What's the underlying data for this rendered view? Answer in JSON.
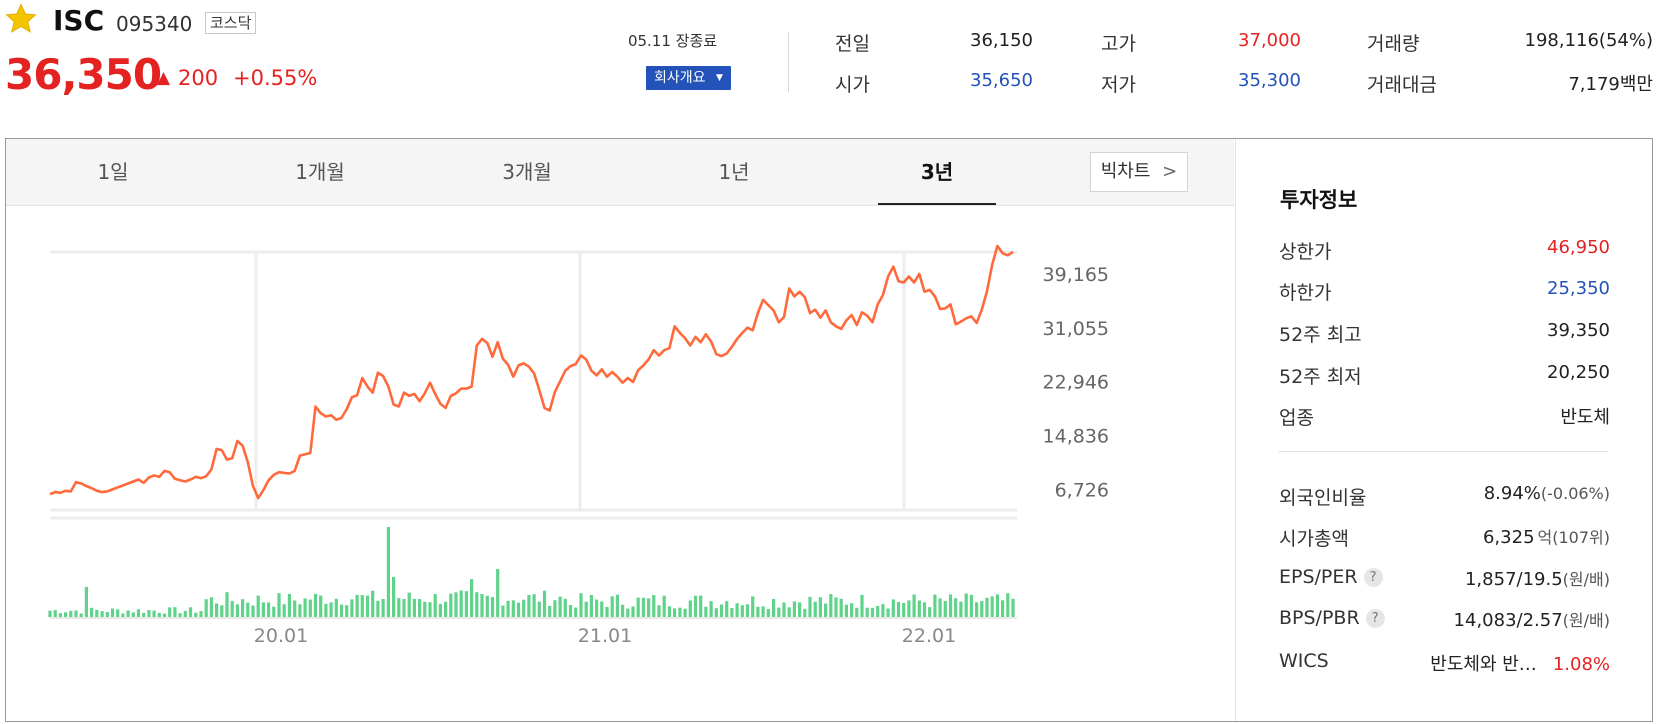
{
  "stock": {
    "name": "ISC",
    "code": "095340",
    "market": "코스닥",
    "price": "36,350",
    "change_arrow": "▲",
    "change": "200",
    "change_pct": "+0.55%",
    "close_info": "05.11 장종료",
    "company_btn": "회사개요",
    "star_color": "#f5c400",
    "up_color": "#e52222",
    "down_color": "#2352b8"
  },
  "summary": {
    "col1": [
      {
        "label": "전일",
        "value": "36,150",
        "tone": ""
      },
      {
        "label": "시가",
        "value": "35,650",
        "tone": "blue"
      }
    ],
    "col2": [
      {
        "label": "고가",
        "value": "37,000",
        "tone": "red"
      },
      {
        "label": "저가",
        "value": "35,300",
        "tone": "blue"
      }
    ],
    "col3": [
      {
        "label": "거래량",
        "value": "198,116(54%)",
        "tone": ""
      },
      {
        "label": "거래대금",
        "value": "7,179백만",
        "tone": ""
      }
    ]
  },
  "tabs": [
    {
      "label": "1일",
      "active": false
    },
    {
      "label": "1개월",
      "active": false
    },
    {
      "label": "3개월",
      "active": false
    },
    {
      "label": "1년",
      "active": false
    },
    {
      "label": "3년",
      "active": true
    }
  ],
  "big_chart": {
    "label": "빅차트",
    "icon": "chevron-right-icon"
  },
  "chart_data": {
    "type": "line",
    "y_ticks": [
      "39,165",
      "31,055",
      "22,946",
      "14,836",
      "6,726"
    ],
    "y_tick_values": [
      39165,
      31055,
      22946,
      14836,
      6726
    ],
    "x_ticks": [
      "20.01",
      "21.01",
      "22.01"
    ],
    "ylim": [
      3600,
      42500
    ],
    "line_color": "#ff6a3d",
    "volume_color": "#5fd38a",
    "price_series": [
      6000,
      6300,
      6200,
      6500,
      6400,
      7800,
      7600,
      7200,
      6900,
      6500,
      6300,
      6400,
      6700,
      7000,
      7300,
      7600,
      7900,
      8200,
      7700,
      8500,
      8800,
      8600,
      9500,
      9300,
      8300,
      8100,
      7900,
      8200,
      8600,
      8400,
      8700,
      9700,
      12800,
      12600,
      11200,
      11400,
      14000,
      13300,
      10800,
      7200,
      5400,
      6600,
      8100,
      8900,
      9300,
      9200,
      9100,
      9500,
      11800,
      12000,
      12200,
      19200,
      18200,
      17700,
      17900,
      17200,
      17500,
      18800,
      20600,
      20900,
      23500,
      22200,
      21300,
      24300,
      23800,
      22200,
      19500,
      19200,
      21300,
      20800,
      21100,
      20000,
      21200,
      22800,
      21100,
      19600,
      19000,
      20800,
      21200,
      21900,
      21900,
      22200,
      28400,
      29400,
      28800,
      26700,
      28900,
      26400,
      25500,
      23700,
      25400,
      25700,
      25200,
      24200,
      21700,
      19000,
      18600,
      21400,
      23000,
      24600,
      25300,
      25600,
      26900,
      26300,
      24600,
      23900,
      24800,
      23700,
      24400,
      23700,
      22800,
      23500,
      22900,
      24700,
      25400,
      26300,
      27700,
      26900,
      27700,
      28000,
      31300,
      30300,
      29500,
      28400,
      29700,
      28900,
      30100,
      29000,
      27100,
      26800,
      27200,
      28200,
      29400,
      30300,
      31100,
      30700,
      33300,
      35300,
      34500,
      33700,
      31900,
      32700,
      37000,
      35800,
      36500,
      35700,
      33300,
      33800,
      32600,
      33700,
      31900,
      31300,
      30900,
      32200,
      33000,
      31500,
      33400,
      32900,
      31900,
      34600,
      36000,
      38800,
      40300,
      38100,
      37900,
      38800,
      37900,
      39200,
      36500,
      36800,
      35800,
      33900,
      34000,
      34600,
      31600,
      32000,
      32500,
      32800,
      31800,
      33800,
      36600,
      40600,
      43400,
      42300,
      42000,
      42500
    ]
  },
  "invest": {
    "title": "투자정보",
    "limits": [
      {
        "label": "상한가",
        "value": "46,950",
        "tone": "red"
      },
      {
        "label": "하한가",
        "value": "25,350",
        "tone": "blue"
      },
      {
        "label": "52주 최고",
        "value": "39,350",
        "tone": ""
      },
      {
        "label": "52주 최저",
        "value": "20,250",
        "tone": ""
      },
      {
        "label": "업종",
        "value": "반도체",
        "tone": ""
      }
    ],
    "foreign_label": "외국인비율",
    "foreign_value": "8.94%",
    "foreign_change": "(-0.06%)",
    "mcap_label": "시가총액",
    "mcap_value": "6,325",
    "mcap_unit": "억",
    "mcap_rank": "(107위)",
    "eps_label": "EPS/PER",
    "eps_value": "1,857/19.5",
    "eps_unit": "(원/배)",
    "bps_label": "BPS/PBR",
    "bps_value": "14,083/2.57",
    "bps_unit": "(원/배)",
    "help_mark": "?",
    "wics_label": "WICS",
    "wics_value": "반도체와 반…",
    "wics_pct": "1.08%"
  }
}
